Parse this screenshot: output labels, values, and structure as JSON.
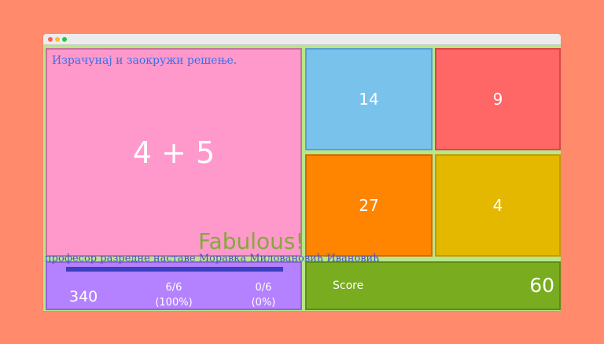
{
  "question": {
    "instruction": "Израчунај и заокружи решење.",
    "expression": "4 + 5"
  },
  "answers": [
    "14",
    "9",
    "27",
    "4"
  ],
  "stats": {
    "points": "340",
    "correct": "6/6",
    "correct_percent": "(100%)",
    "wrong": "0/6",
    "wrong_percent": "(0%)",
    "progress": 1.0
  },
  "score": {
    "label": "Score",
    "value": "60"
  },
  "feedback": "Fabulous!",
  "credit": "професор разредне наставе Моравка Миловановић Ивановић"
}
